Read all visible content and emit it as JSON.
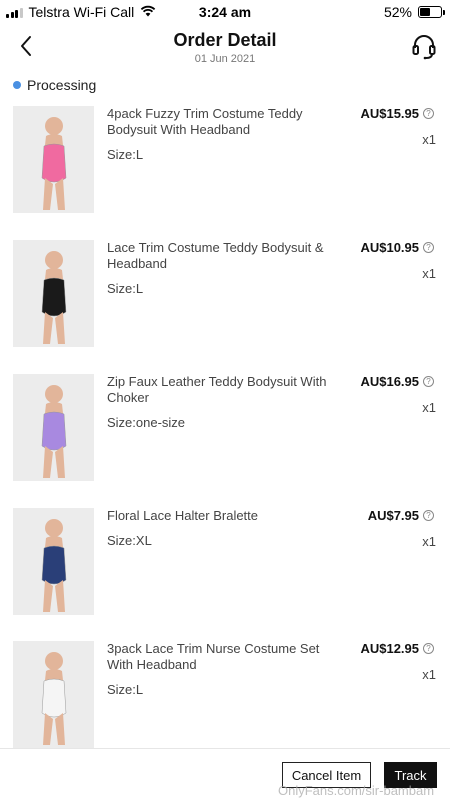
{
  "status_bar": {
    "carrier": "Telstra Wi-Fi Call",
    "time": "3:24 am",
    "battery": "52%",
    "battery_level": 0.52,
    "signal_bars_filled": 3,
    "signal_bars_total": 4
  },
  "header": {
    "title": "Order Detail",
    "date": "01 Jun 2021",
    "back_icon": "chevron-left-icon",
    "support_icon": "headset-icon"
  },
  "order_status": {
    "label": "Processing",
    "dot_color": "#4a90e2"
  },
  "items": [
    {
      "name": "4pack Fuzzy Trim Costume Teddy Bodysuit With Headband",
      "size": "Size:L",
      "price": "AU$15.95",
      "qty": "x1",
      "thumb_color": "#f06aa0"
    },
    {
      "name": "Lace Trim Costume Teddy Bodysuit & Headband",
      "size": "Size:L",
      "price": "AU$10.95",
      "qty": "x1",
      "thumb_color": "#1a1a1a"
    },
    {
      "name": "Zip Faux Leather Teddy Bodysuit With Choker",
      "size": "Size:one-size",
      "price": "AU$16.95",
      "qty": "x1",
      "thumb_color": "#a889e0"
    },
    {
      "name": "Floral Lace Halter Bralette",
      "size": "Size:XL",
      "price": "AU$7.95",
      "qty": "x1",
      "thumb_color": "#2a3f78"
    },
    {
      "name": "3pack Lace Trim Nurse Costume Set With Headband",
      "size": "Size:L",
      "price": "AU$12.95",
      "qty": "x1",
      "thumb_color": "#f5f5f5"
    }
  ],
  "actions": {
    "cancel_label": "Cancel Item",
    "track_label": "Track"
  },
  "watermark": "OnlyFans.com/sir-bambam"
}
